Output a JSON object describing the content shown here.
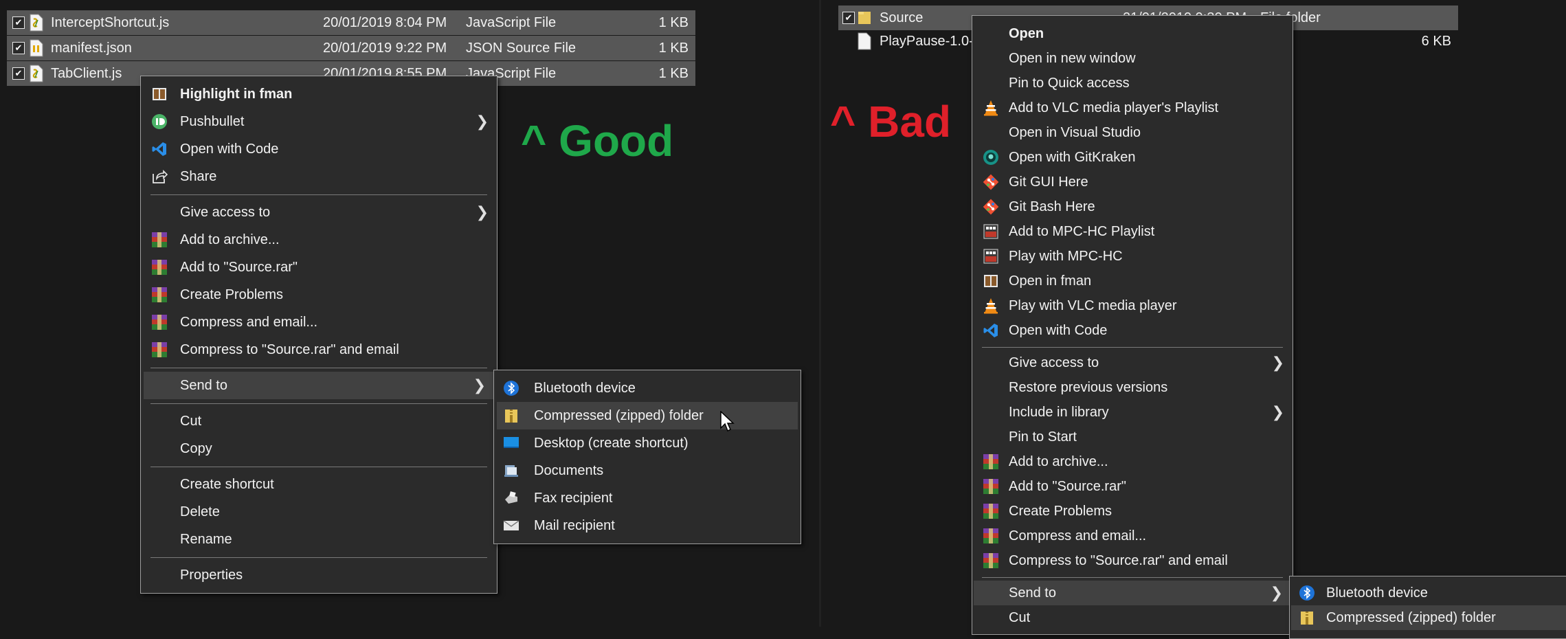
{
  "left": {
    "files": [
      {
        "name": "InterceptShortcut.js",
        "date": "20/01/2019 8:04 PM",
        "type": "JavaScript File",
        "size": "1 KB",
        "icon": "js-file-icon"
      },
      {
        "name": "manifest.json",
        "date": "20/01/2019 9:22 PM",
        "type": "JSON Source File",
        "size": "1 KB",
        "icon": "json-file-icon"
      },
      {
        "name": "TabClient.js",
        "date": "20/01/2019 8:55 PM",
        "type": "JavaScript File",
        "size": "1 KB",
        "icon": "js-file-icon"
      }
    ],
    "menu": [
      {
        "label": "Highlight in fman",
        "icon": "fman-icon",
        "bold": true
      },
      {
        "label": "Pushbullet",
        "icon": "pushbullet-icon",
        "submenu": true
      },
      {
        "label": "Open with Code",
        "icon": "vscode-icon"
      },
      {
        "label": "Share",
        "icon": "share-icon"
      },
      {
        "label": "Give access to",
        "submenu": true
      },
      {
        "label": "Add to archive...",
        "icon": "winrar-icon"
      },
      {
        "label": "Add to \"Source.rar\"",
        "icon": "winrar-icon"
      },
      {
        "label": "Create Problems",
        "icon": "winrar-icon"
      },
      {
        "label": "Compress and email...",
        "icon": "winrar-icon"
      },
      {
        "label": "Compress to \"Source.rar\" and email",
        "icon": "winrar-icon"
      },
      {
        "label": "Send to",
        "submenu": true,
        "highlighted": true
      },
      {
        "label": "Cut"
      },
      {
        "label": "Copy"
      },
      {
        "label": "Create shortcut"
      },
      {
        "label": "Delete"
      },
      {
        "label": "Rename"
      },
      {
        "label": "Properties"
      }
    ],
    "sendto": [
      {
        "label": "Bluetooth device",
        "icon": "bluetooth-icon"
      },
      {
        "label": "Compressed (zipped) folder",
        "icon": "zip-folder-icon",
        "highlighted": true
      },
      {
        "label": "Desktop (create shortcut)",
        "icon": "desktop-icon"
      },
      {
        "label": "Documents",
        "icon": "documents-icon"
      },
      {
        "label": "Fax recipient",
        "icon": "fax-icon"
      },
      {
        "label": "Mail recipient",
        "icon": "mail-icon"
      }
    ],
    "annotation": "^ Good"
  },
  "right": {
    "files": [
      {
        "name": "Source",
        "date": "21/01/2019 9:30 PM",
        "type": "File folder",
        "size": "",
        "icon": "folder-icon"
      },
      {
        "name": "PlayPause-1.0-si",
        "date": "",
        "type": "",
        "size": "6 KB",
        "icon": "file-icon"
      }
    ],
    "menu": [
      {
        "label": "Open",
        "bold": true
      },
      {
        "label": "Open in new window"
      },
      {
        "label": "Pin to Quick access"
      },
      {
        "label": "Add to VLC media player's Playlist",
        "icon": "vlc-icon"
      },
      {
        "label": "Open in Visual Studio"
      },
      {
        "label": "Open with GitKraken",
        "icon": "gitkraken-icon"
      },
      {
        "label": "Git GUI Here",
        "icon": "git-icon"
      },
      {
        "label": "Git Bash Here",
        "icon": "git-icon"
      },
      {
        "label": "Add to MPC-HC Playlist",
        "icon": "mpc-icon"
      },
      {
        "label": "Play with MPC-HC",
        "icon": "mpc-icon"
      },
      {
        "label": "Open in fman",
        "icon": "fman-icon"
      },
      {
        "label": "Play with VLC media player",
        "icon": "vlc-icon"
      },
      {
        "label": "Open with Code",
        "icon": "vscode-icon"
      },
      {
        "label": "Give access to",
        "submenu": true
      },
      {
        "label": "Restore previous versions"
      },
      {
        "label": "Include in library",
        "submenu": true
      },
      {
        "label": "Pin to Start"
      },
      {
        "label": "Add to archive...",
        "icon": "winrar-icon"
      },
      {
        "label": "Add to \"Source.rar\"",
        "icon": "winrar-icon"
      },
      {
        "label": "Create Problems",
        "icon": "winrar-icon"
      },
      {
        "label": "Compress and email...",
        "icon": "winrar-icon"
      },
      {
        "label": "Compress to \"Source.rar\" and email",
        "icon": "winrar-icon"
      },
      {
        "label": "Send to",
        "submenu": true,
        "highlighted": true
      },
      {
        "label": "Cut"
      }
    ],
    "sendto": [
      {
        "label": "Bluetooth device",
        "icon": "bluetooth-icon"
      },
      {
        "label": "Compressed (zipped) folder",
        "icon": "zip-folder-icon",
        "highlighted": true
      }
    ],
    "annotation": "^ Bad"
  },
  "colors": {
    "good": "#1fa84a",
    "bad": "#e0202a",
    "menu_bg": "#2b2b2b",
    "highlight": "#414141",
    "file_row_bg": "#575757"
  }
}
